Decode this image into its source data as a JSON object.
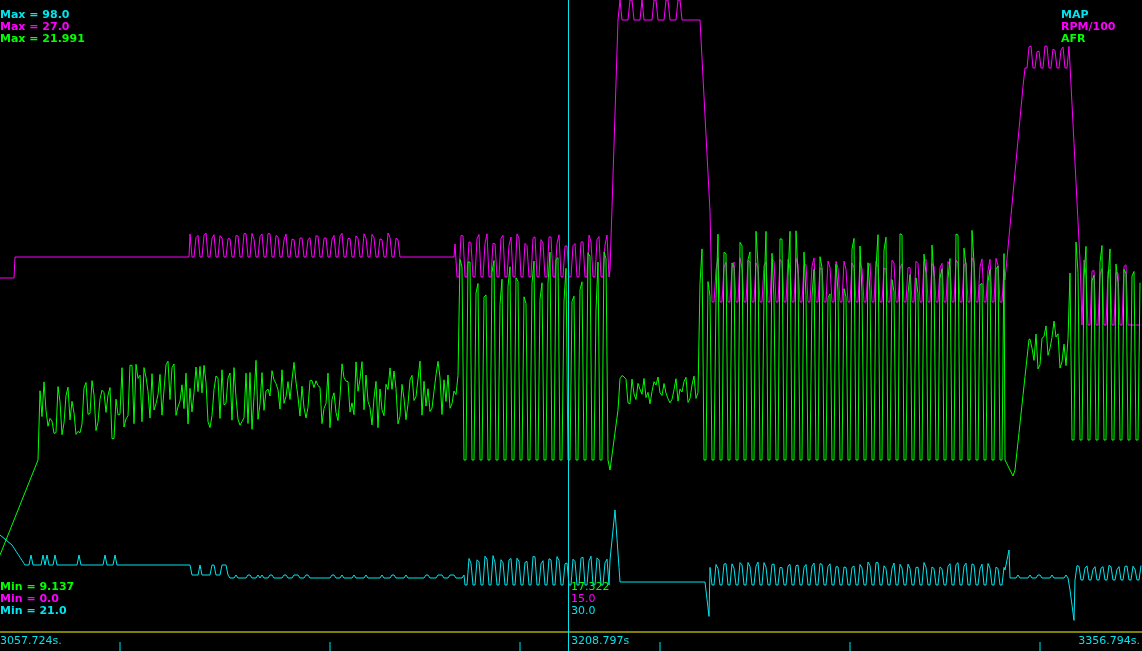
{
  "max_labels": [
    {
      "text": "Max = 98.0",
      "color": "#00e5ee"
    },
    {
      "text": "Max = 27.0",
      "color": "#ff00ff"
    },
    {
      "text": "Max = 21.991",
      "color": "#00ff00"
    }
  ],
  "legend": [
    {
      "label": "MAP",
      "color": "#00e5ee"
    },
    {
      "label": "RPM/100",
      "color": "#ff00ff"
    },
    {
      "label": "AFR",
      "color": "#00ff00"
    }
  ],
  "min_labels": [
    {
      "text": "Min = 9.137",
      "color": "#00ff00"
    },
    {
      "text": "Min = 0.0",
      "color": "#ff00ff"
    },
    {
      "text": "Min = 21.0",
      "color": "#00e5ee"
    }
  ],
  "cursor": {
    "readouts": [
      {
        "text": "17.322",
        "color": "#00ff00"
      },
      {
        "text": "15.0",
        "color": "#ff00ff"
      },
      {
        "text": "30.0",
        "color": "#00e5ee"
      }
    ],
    "time": "3208.797s"
  },
  "time_axis": {
    "start": "3057.724s.",
    "end": "3356.794s."
  }
}
